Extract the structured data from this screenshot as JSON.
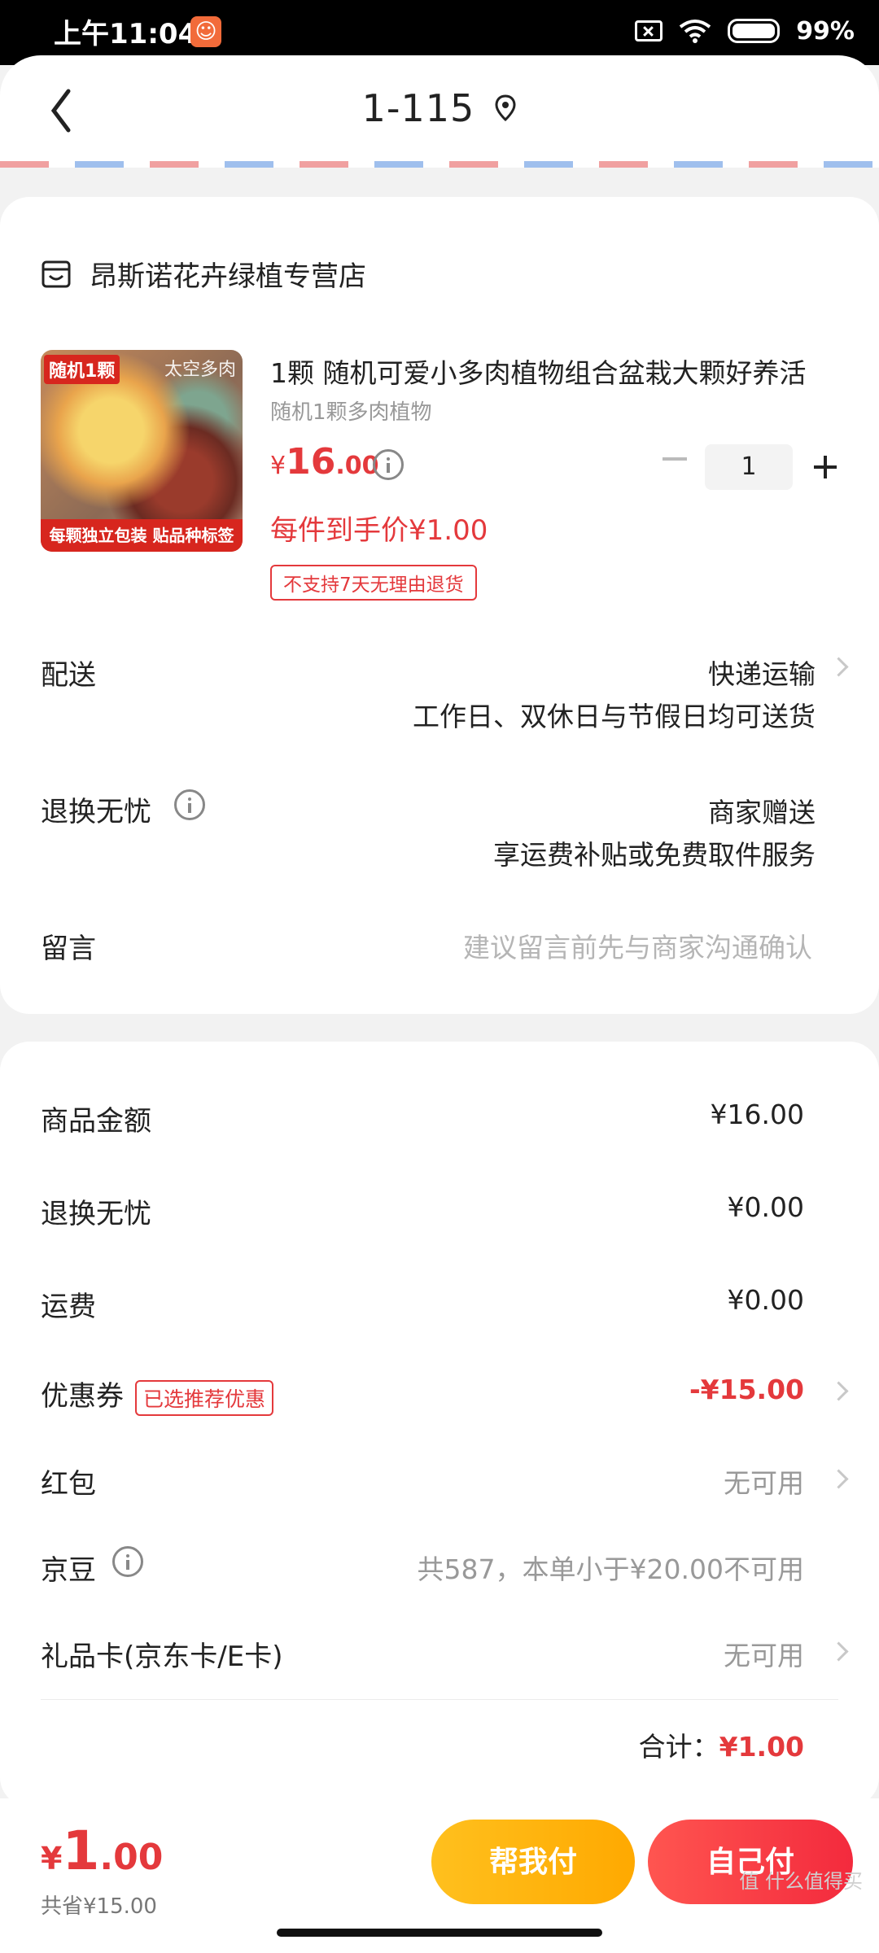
{
  "status_bar": {
    "time": "上午11:04",
    "battery": "99%",
    "app_icon": "app-notification-icon"
  },
  "header": {
    "title": "1-115",
    "location_icon": "location-pin-icon"
  },
  "shop": {
    "name": "昂斯诺花卉绿植专营店",
    "icon": "store-icon"
  },
  "product": {
    "title": "1颗 随机可爱小多肉植物组合盆栽大颗好养活",
    "subtitle": "随机1颗多肉植物",
    "price_symbol": "¥",
    "price_int": "16",
    "price_dec": ".00",
    "quantity": "1",
    "promo_price": "每件到手价¥1.00",
    "return_tag": "不支持7天无理由退货",
    "image": {
      "tag_tl": "随机1颗",
      "tag_tr": "太空多肉",
      "banner": "每颗独立包装 贴品种标签"
    }
  },
  "delivery": {
    "label": "配送",
    "method": "快递运输",
    "note": "工作日、双休日与节假日均可送货"
  },
  "worry_free": {
    "label": "退换无忧",
    "value": "商家赠送",
    "note": "享运费补贴或免费取件服务"
  },
  "message": {
    "label": "留言",
    "placeholder": "建议留言前先与商家沟通确认"
  },
  "costs": {
    "goods": {
      "label": "商品金额",
      "value": "¥16.00"
    },
    "worry_free": {
      "label": "退换无忧",
      "value": "¥0.00"
    },
    "shipping": {
      "label": "运费",
      "value": "¥0.00"
    },
    "coupon": {
      "label": "优惠券",
      "tag": "已选推荐优惠",
      "value": "-¥15.00"
    },
    "red_packet": {
      "label": "红包",
      "value": "无可用"
    },
    "jingdou": {
      "label": "京豆",
      "value": "共587，本单小于¥20.00不可用"
    },
    "gift_card": {
      "label": "礼品卡(京东卡/E卡)",
      "value": "无可用"
    },
    "total_label": "合计：",
    "total_value": "¥1.00"
  },
  "bottom": {
    "sym": "¥",
    "int": "1",
    "dec": ".00",
    "saved": "共省¥15.00",
    "help_pay": "帮我付",
    "self_pay": "自己付",
    "watermark": "值 什么值得买"
  },
  "colors": {
    "accent_red": "#e4393c",
    "help_yellow": "#ffb400",
    "pay_red": "#f5333f"
  }
}
